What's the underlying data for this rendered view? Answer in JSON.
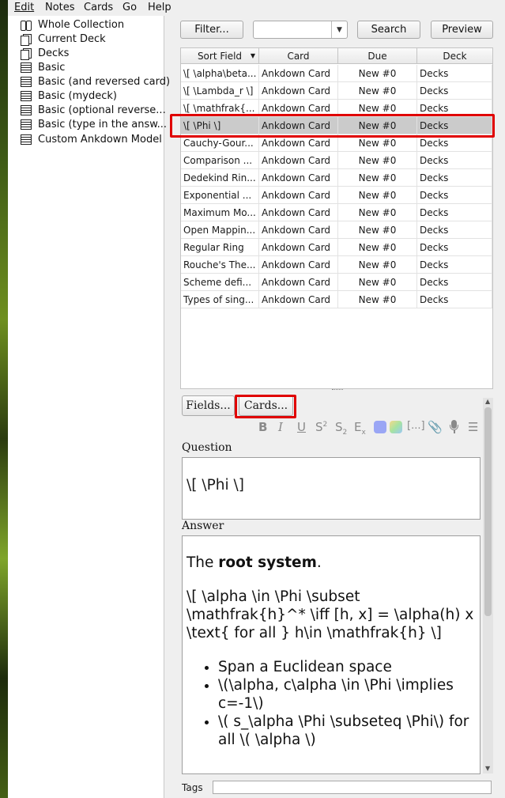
{
  "menu": [
    "Edit",
    "Notes",
    "Cards",
    "Go",
    "Help"
  ],
  "sidebar": {
    "items": [
      {
        "label": "Whole Collection",
        "icon": "collection-icon"
      },
      {
        "label": "Current Deck",
        "icon": "deck-icon"
      },
      {
        "label": "Decks",
        "icon": "deck-icon"
      },
      {
        "label": "Basic",
        "icon": "note-type-icon"
      },
      {
        "label": "Basic (and reversed card)",
        "icon": "note-type-icon"
      },
      {
        "label": "Basic (mydeck)",
        "icon": "note-type-icon"
      },
      {
        "label": "Basic (optional reverse...",
        "icon": "note-type-icon"
      },
      {
        "label": "Basic (type in the answ...",
        "icon": "note-type-icon"
      },
      {
        "label": "Custom Ankdown Model",
        "icon": "note-type-icon"
      }
    ]
  },
  "toolbar": {
    "filter_label": "Filter...",
    "search_value": "",
    "search_label": "Search",
    "preview_label": "Preview"
  },
  "table": {
    "headers": [
      "Sort Field",
      "Card",
      "Due",
      "Deck"
    ],
    "rows": [
      [
        "\\[ \\alpha\\beta...",
        "Ankdown Card",
        "New #0",
        "Decks"
      ],
      [
        "\\[ \\Lambda_r \\]",
        "Ankdown Card",
        "New #0",
        "Decks"
      ],
      [
        "\\[ \\mathfrak{...",
        "Ankdown Card",
        "New #0",
        "Decks"
      ],
      [
        "\\[ \\Phi \\]",
        "Ankdown Card",
        "New #0",
        "Decks"
      ],
      [
        "Cauchy-Gour...",
        "Ankdown Card",
        "New #0",
        "Decks"
      ],
      [
        "Comparison ...",
        "Ankdown Card",
        "New #0",
        "Decks"
      ],
      [
        "Dedekind Rin...",
        "Ankdown Card",
        "New #0",
        "Decks"
      ],
      [
        "Exponential ...",
        "Ankdown Card",
        "New #0",
        "Decks"
      ],
      [
        "Maximum Mo...",
        "Ankdown Card",
        "New #0",
        "Decks"
      ],
      [
        "Open Mappin...",
        "Ankdown Card",
        "New #0",
        "Decks"
      ],
      [
        "Regular Ring",
        "Ankdown Card",
        "New #0",
        "Decks"
      ],
      [
        "Rouche's The...",
        "Ankdown Card",
        "New #0",
        "Decks"
      ],
      [
        "Scheme defi...",
        "Ankdown Card",
        "New #0",
        "Decks"
      ],
      [
        "Types of sing...",
        "Ankdown Card",
        "New #0",
        "Decks"
      ]
    ],
    "selected_row": 3,
    "selection_color": "#cbcbcb"
  },
  "editor": {
    "fields_button": "Fields...",
    "cards_button": "Cards...",
    "format_icons": [
      "bold-icon",
      "italic-icon",
      "underline-icon",
      "superscript-icon",
      "subscript-icon",
      "clear-format-icon",
      "text-color-icon",
      "highlight-color-icon",
      "cloze-icon",
      "attachment-icon",
      "record-audio-icon",
      "more-icon"
    ],
    "question_label": "Question",
    "question_value": "\\[ \\Phi \\]",
    "answer_label": "Answer",
    "answer": {
      "intro_pre": "The ",
      "intro_bold": "root system",
      "intro_post": ".",
      "formula": "\\[ \\alpha \\in \\Phi \\subset \\mathfrak{h}^* \\iff [h, x] = \\alpha(h) x \\text{ for all } h\\in \\mathfrak{h} \\]",
      "bullets": [
        "Span a Euclidean space",
        "\\(\\alpha, c\\alpha \\in \\Phi \\implies c=-1\\)",
        "\\( s_\\alpha \\Phi \\subseteq \\Phi\\) for all \\( \\alpha \\)"
      ]
    },
    "tags_label": "Tags",
    "tags_value": ""
  },
  "colors": {
    "highlight": "#e00000",
    "accent_blue": "#9aa6f5"
  }
}
